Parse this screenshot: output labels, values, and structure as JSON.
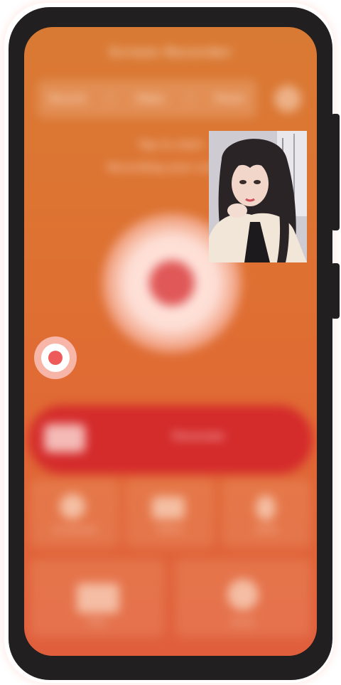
{
  "app": {
    "title": "Screen Recorder"
  },
  "tabs": [
    {
      "label": "Record"
    },
    {
      "label": "Video"
    },
    {
      "label": "Photo"
    }
  ],
  "status": {
    "line1": "Tap to start",
    "line2": "Recording your screen"
  },
  "camera_bar": {
    "label": "Facecam"
  },
  "grid_row1": [
    {
      "label": "Screenshot"
    },
    {
      "label": "Videos"
    },
    {
      "label": "Audio"
    }
  ],
  "grid_row2": [
    {
      "label": "Files"
    },
    {
      "label": "Brush"
    }
  ],
  "pip": {
    "subject": "facecam-preview"
  },
  "colors": {
    "accent_red": "#d42b2b",
    "record_dot": "#ee5a5a",
    "device_frame": "#221f21"
  }
}
